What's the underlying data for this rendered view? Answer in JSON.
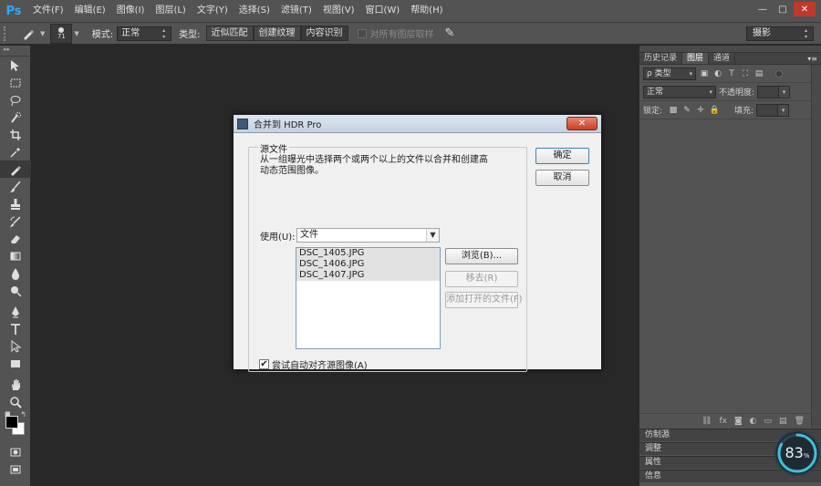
{
  "app": {
    "logo": "Ps",
    "menu": [
      "文件(F)",
      "编辑(E)",
      "图像(I)",
      "图层(L)",
      "文字(Y)",
      "选择(S)",
      "滤镜(T)",
      "视图(V)",
      "窗口(W)",
      "帮助(H)"
    ],
    "window_controls": {
      "minimize": "—",
      "maximize": "□",
      "close": "✕"
    }
  },
  "options_bar": {
    "brush_size": "71",
    "mode_label": "模式:",
    "mode_value": "正常",
    "type_label": "类型:",
    "type_options": [
      "近似匹配",
      "创建纹理",
      "内容识别"
    ],
    "sample_all_label": "对所有图层取样",
    "workspace": "摄影"
  },
  "right_panel": {
    "top_tabs": [
      "历史记录",
      "图层",
      "通道"
    ],
    "active_tab": "图层",
    "filter_label": "ρ 类型",
    "blend_mode": "正常",
    "opacity_label": "不透明度:",
    "lock_label": "锁定:",
    "fill_label": "填充:",
    "bottom_icons": [
      "link-icon",
      "fx-icon",
      "mask-icon",
      "adjustment-icon",
      "folder-icon",
      "new-layer-icon",
      "trash-icon"
    ],
    "collapsed_panels": [
      "仿制源",
      "调整",
      "属性",
      "信息"
    ]
  },
  "progress": {
    "value": "83",
    "unit": "%",
    "ratio": 0.83,
    "color": "#3fc1d8"
  },
  "dialog": {
    "title": "合并到 HDR Pro",
    "group_title": "源文件",
    "description": "从一组曝光中选择两个或两个以上的文件以合并和创建高动态范围图像。",
    "use_label": "使用(U):",
    "use_value": "文件",
    "files": [
      "DSC_1405.JPG",
      "DSC_1406.JPG",
      "DSC_1407.JPG"
    ],
    "browse_button": "浏览(B)...",
    "remove_button": "移去(R)",
    "add_open_button": "添加打开的文件(F)",
    "ok_button": "确定",
    "cancel_button": "取消",
    "align_checkbox_label": "尝试自动对齐源图像(A)",
    "align_checked": "✔",
    "close_glyph": "✕"
  }
}
